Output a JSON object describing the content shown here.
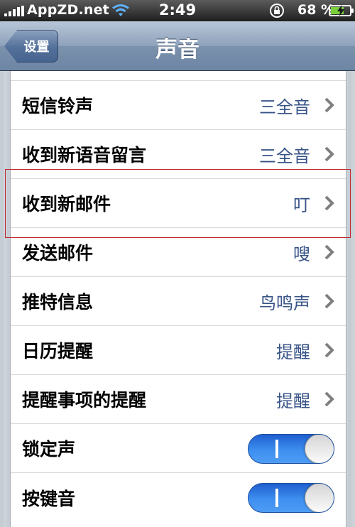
{
  "status_bar": {
    "carrier": "AppZD.net",
    "time": "2:49",
    "battery_percent": "68 %",
    "battery_level": 0.68
  },
  "nav": {
    "back_label": "设置",
    "title": "声音"
  },
  "rows": [
    {
      "label": "短信铃声",
      "value": "三全音"
    },
    {
      "label": "收到新语音留言",
      "value": "三全音"
    },
    {
      "label": "收到新邮件",
      "value": "叮"
    },
    {
      "label": "发送邮件",
      "value": "嗖"
    },
    {
      "label": "推特信息",
      "value": "鸟鸣声"
    },
    {
      "label": "日历提醒",
      "value": "提醒"
    },
    {
      "label": "提醒事项的提醒",
      "value": "提醒"
    }
  ],
  "toggles": [
    {
      "label": "锁定声",
      "on": true
    },
    {
      "label": "按键音",
      "on": true
    }
  ],
  "colors": {
    "accent": "#385487",
    "toggle_on": "#3e8ff0",
    "highlight": "#c1272d"
  }
}
